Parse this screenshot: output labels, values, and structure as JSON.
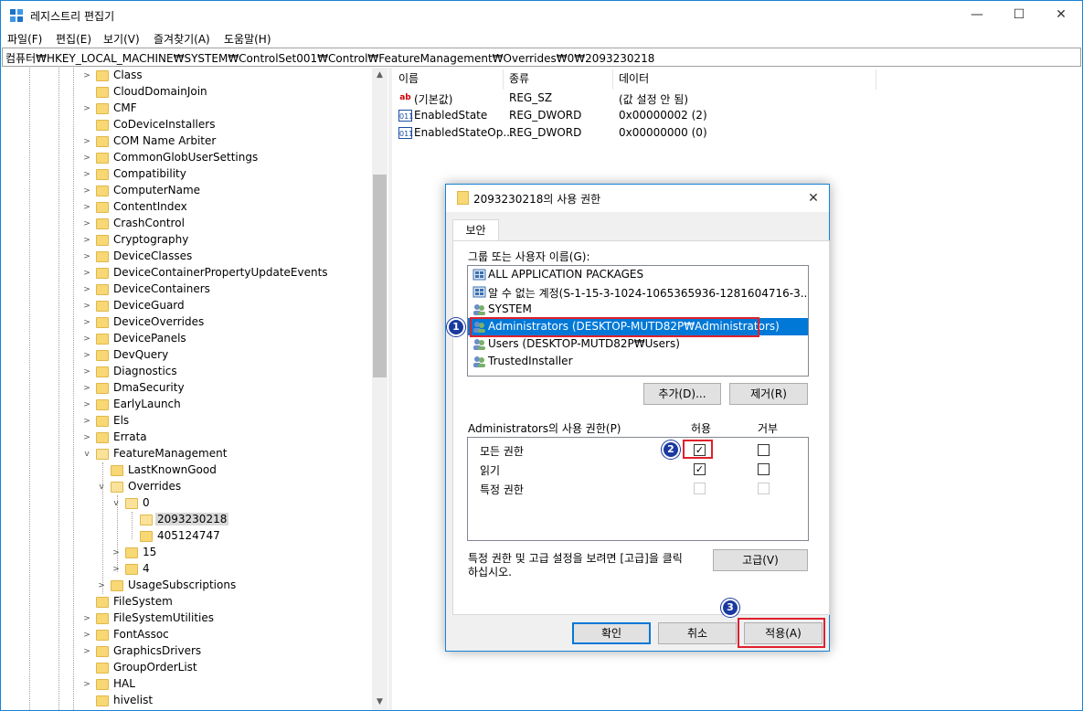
{
  "window": {
    "title": "레지스트리 편집기",
    "minimize": "—",
    "maximize": "☐",
    "close": "✕"
  },
  "menu": [
    "파일(F)",
    "편집(E)",
    "보기(V)",
    "즐겨찾기(A)",
    "도움말(H)"
  ],
  "address": "컴퓨터₩HKEY_LOCAL_MACHINE₩SYSTEM₩ControlSet001₩Control₩FeatureManagement₩Overrides₩0₩2093230218",
  "tree": [
    {
      "label": "Class"
    },
    {
      "label": "CloudDomainJoin"
    },
    {
      "label": "CMF"
    },
    {
      "label": "CoDeviceInstallers"
    },
    {
      "label": "COM Name Arbiter"
    },
    {
      "label": "CommonGlobUserSettings"
    },
    {
      "label": "Compatibility"
    },
    {
      "label": "ComputerName"
    },
    {
      "label": "ContentIndex"
    },
    {
      "label": "CrashControl"
    },
    {
      "label": "Cryptography"
    },
    {
      "label": "DeviceClasses"
    },
    {
      "label": "DeviceContainerPropertyUpdateEvents"
    },
    {
      "label": "DeviceContainers"
    },
    {
      "label": "DeviceGuard"
    },
    {
      "label": "DeviceOverrides"
    },
    {
      "label": "DevicePanels"
    },
    {
      "label": "DevQuery"
    },
    {
      "label": "Diagnostics"
    },
    {
      "label": "DmaSecurity"
    },
    {
      "label": "EarlyLaunch"
    },
    {
      "label": "Els"
    },
    {
      "label": "Errata"
    },
    {
      "label": "FeatureManagement"
    },
    {
      "label": "LastKnownGood"
    },
    {
      "label": "Overrides"
    },
    {
      "label": "0"
    },
    {
      "label": "2093230218"
    },
    {
      "label": "405124747"
    },
    {
      "label": "15"
    },
    {
      "label": "4"
    },
    {
      "label": "UsageSubscriptions"
    },
    {
      "label": "FileSystem"
    },
    {
      "label": "FileSystemUtilities"
    },
    {
      "label": "FontAssoc"
    },
    {
      "label": "GraphicsDrivers"
    },
    {
      "label": "GroupOrderList"
    },
    {
      "label": "HAL"
    },
    {
      "label": "hivelist"
    }
  ],
  "list": {
    "headers": [
      "이름",
      "종류",
      "데이터"
    ],
    "rows": [
      {
        "icon": "ab",
        "name": "(기본값)",
        "type": "REG_SZ",
        "data": "(값 설정 안 됨)"
      },
      {
        "icon": "011",
        "name": "EnabledState",
        "type": "REG_DWORD",
        "data": "0x00000002 (2)"
      },
      {
        "icon": "011",
        "name": "EnabledStateOp...",
        "type": "REG_DWORD",
        "data": "0x00000000 (0)"
      }
    ]
  },
  "dialog": {
    "title": "2093230218의 사용 권한",
    "tab": "보안",
    "group_label": "그룹 또는 사용자 이름(G):",
    "users": [
      "ALL APPLICATION PACKAGES",
      "알 수 없는 계정(S-1-15-3-1024-1065365936-1281604716-3...",
      "SYSTEM",
      "Administrators (DESKTOP-MUTD82P₩Administrators)",
      "Users (DESKTOP-MUTD82P₩Users)",
      "TrustedInstaller"
    ],
    "add_button": "추가(D)...",
    "remove_button": "제거(R)",
    "perm_label": "Administrators의 사용 권한(P)",
    "allow_header": "허용",
    "deny_header": "거부",
    "permissions": [
      {
        "name": "모든 권한",
        "allow": "✓",
        "deny": ""
      },
      {
        "name": "읽기",
        "allow": "✓",
        "deny": ""
      },
      {
        "name": "특정 권한",
        "allow": "",
        "deny": ""
      }
    ],
    "advanced_text_1": "특정 권한 및 고급 설정을 보려면 [고급]을 클릭",
    "advanced_text_2": "하십시오.",
    "advanced_button": "고급(V)",
    "ok_button": "확인",
    "cancel_button": "취소",
    "apply_button": "적용(A)"
  },
  "callouts": [
    "1",
    "2",
    "3"
  ],
  "colors": {
    "selection": "#0078d7",
    "callout": "#1b3aa0",
    "highlight_box": "#e0202c",
    "folder": "#f8d775"
  }
}
